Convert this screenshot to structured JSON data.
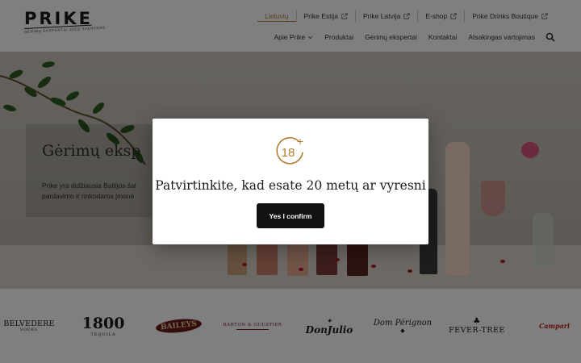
{
  "header": {
    "logo": {
      "word": "PRIKE",
      "tagline": "GĖRIMŲ EKSPERTAI JŪSŲ SVENTĖMS"
    },
    "topnav": [
      {
        "label": "Lietuvių",
        "active": true,
        "external": false
      },
      {
        "label": "Prike Estija",
        "active": false,
        "external": true
      },
      {
        "label": "Prike Latvija",
        "active": false,
        "external": true
      },
      {
        "label": "E-shop",
        "active": false,
        "external": true
      },
      {
        "label": "Prike Drinks Boutique",
        "active": false,
        "external": true
      }
    ],
    "mainnav": [
      {
        "label": "Apie Prike",
        "dropdown": true
      },
      {
        "label": "Produktai",
        "dropdown": false
      },
      {
        "label": "Gėrimų ekspertai",
        "dropdown": false
      },
      {
        "label": "Kontaktai",
        "dropdown": false
      },
      {
        "label": "Atsakingas vartojimas",
        "dropdown": false
      }
    ],
    "icons": {
      "external": "external-link-icon",
      "dropdown": "chevron-down-icon",
      "search": "search-icon"
    }
  },
  "hero": {
    "title": "Gėrimų eksp",
    "text_line1": "Prike yra didžiausia Baltijos šal",
    "text_line2": "pardavimo ir rinkodaros įmonė"
  },
  "brands": [
    {
      "name": "BELVEDERE",
      "sub": "VODKA"
    },
    {
      "name": "1800",
      "sub": "TEQUILA"
    },
    {
      "name": "BAILEYS",
      "sub": ""
    },
    {
      "name": "BARTON & GUESTIER",
      "sub": ""
    },
    {
      "name": "DonJulio",
      "sub": ""
    },
    {
      "name": "Dom Pérignon",
      "sub": ""
    },
    {
      "name": "FEVER-TREE",
      "sub": ""
    },
    {
      "name": "Campari",
      "sub": ""
    }
  ],
  "modal": {
    "badge_text": "18",
    "badge_plus": "+",
    "title": "Patvirtinkite, kad esate 20 metų ar vyresni",
    "confirm_label": "Yes I confirm"
  },
  "colors": {
    "accent": "#b07d2e",
    "overlay": "rgba(0,0,0,0.50)",
    "button": "#111111",
    "wine_red": "#a21c2b"
  }
}
